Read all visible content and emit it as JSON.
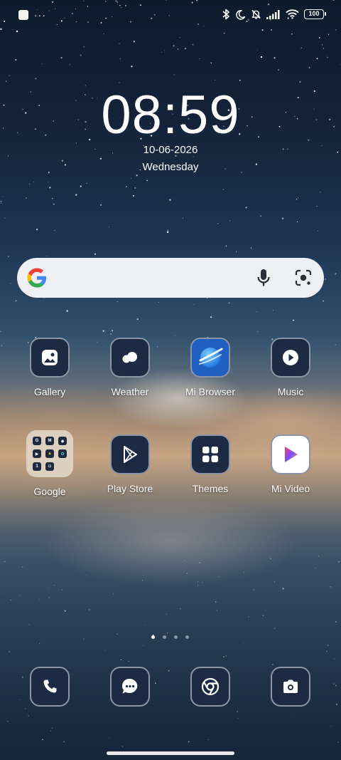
{
  "status_bar": {
    "icons": [
      "notification-square-icon",
      "more-dots-icon",
      "bluetooth-icon",
      "moon-icon",
      "bell-off-icon",
      "signal-icon",
      "wifi-icon",
      "battery-icon"
    ],
    "more_dots": "···",
    "battery": "100"
  },
  "clock": {
    "time": "08:59",
    "date": "10-06-2026",
    "weekday": "Wednesday"
  },
  "search": {
    "icons": [
      "google-g-icon",
      "microphone-icon",
      "lens-icon"
    ]
  },
  "apps": {
    "row1": [
      {
        "label": "Gallery",
        "icon": "gallery-icon"
      },
      {
        "label": "Weather",
        "icon": "weather-icon"
      },
      {
        "label": "Mi Browser",
        "icon": "mi-browser-icon"
      },
      {
        "label": "Music",
        "icon": "music-icon"
      }
    ],
    "row2": [
      {
        "label": "Google",
        "icon": "google-folder-icon"
      },
      {
        "label": "Play Store",
        "icon": "play-store-icon"
      },
      {
        "label": "Themes",
        "icon": "themes-icon"
      },
      {
        "label": "Mi Video",
        "icon": "mi-video-icon"
      }
    ]
  },
  "page_indicator": {
    "pages": 4,
    "current": 1
  },
  "dock": [
    {
      "icon": "phone-icon"
    },
    {
      "icon": "messages-icon"
    },
    {
      "icon": "chrome-icon"
    },
    {
      "icon": "camera-icon"
    }
  ],
  "colors": {
    "icon_bg": "#1c2a44",
    "icon_border": "#8b95a6",
    "search_bg": "#eef0f3"
  }
}
